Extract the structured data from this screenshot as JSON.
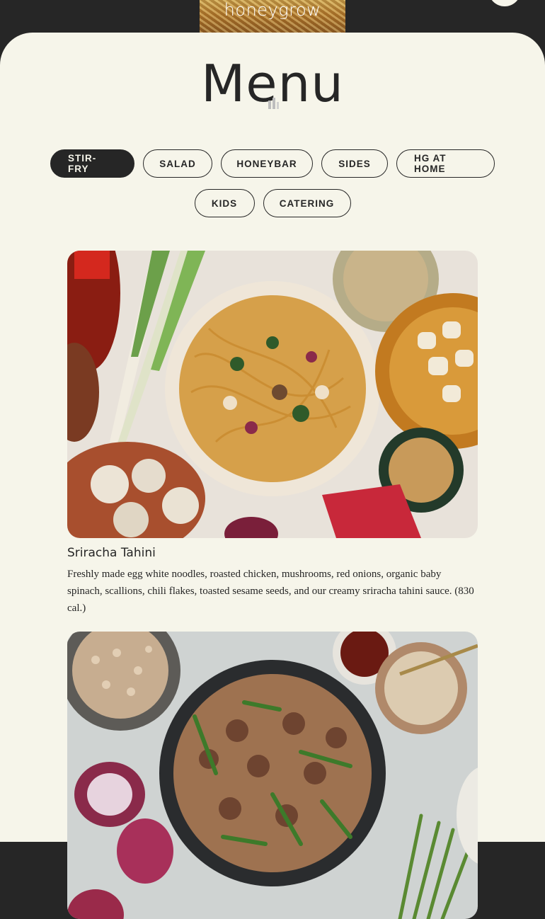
{
  "header": {
    "logo_text": "honeygrow"
  },
  "page_title": "Menu",
  "tabs": [
    {
      "label": "STIR-FRY",
      "active": true
    },
    {
      "label": "SALAD",
      "active": false
    },
    {
      "label": "HONEYBAR",
      "active": false
    },
    {
      "label": "SIDES",
      "active": false
    },
    {
      "label": "HG AT HOME",
      "active": false
    },
    {
      "label": "KIDS",
      "active": false
    },
    {
      "label": "CATERING",
      "active": false
    }
  ],
  "menu_items": [
    {
      "name": "Sriracha Tahini",
      "description": "Freshly made egg white noodles, roasted chicken, mushrooms, red onions, organic baby spinach, scallions, chili flakes, toasted sesame seeds, and our creamy sriracha tahini sauce. (830 cal.)"
    },
    {
      "name": "",
      "description": ""
    }
  ],
  "colors": {
    "dark": "#262626",
    "cream": "#f6f5ea"
  }
}
